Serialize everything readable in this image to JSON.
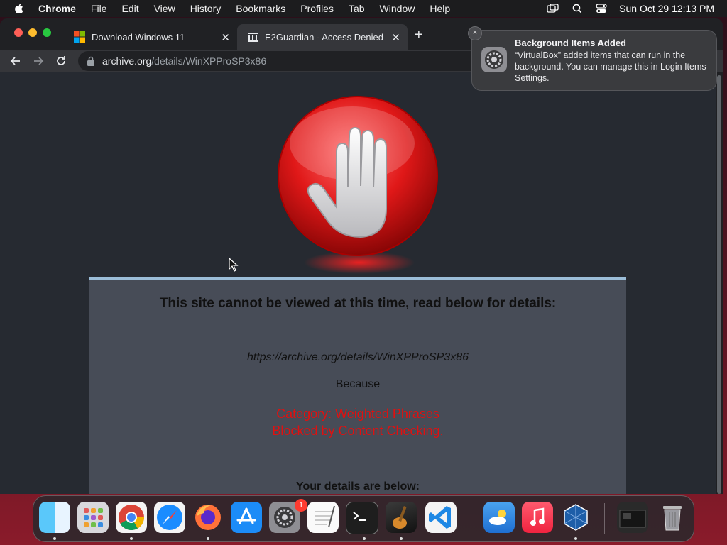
{
  "menubar": {
    "app": "Chrome",
    "items": [
      "File",
      "Edit",
      "View",
      "History",
      "Bookmarks",
      "Profiles",
      "Tab",
      "Window",
      "Help"
    ],
    "clock": "Sun Oct 29  12:13 PM"
  },
  "browser": {
    "tabs": [
      {
        "title": "Download Windows 11",
        "active": false
      },
      {
        "title": "E2Guardian - Access Denied",
        "active": true
      }
    ],
    "new_tab": "+",
    "address": {
      "host": "archive.org",
      "path": "/details/WinXPProSP3x86"
    }
  },
  "page": {
    "heading": "This site cannot be viewed at this time, read below for details:",
    "url": "https://archive.org/details/WinXPProSP3x86",
    "because": "Because",
    "reason_1": "Category: Weighted Phrases",
    "reason_2": "Blocked by Content Checking.",
    "details_heading": "Your details are below:"
  },
  "notification": {
    "title": "Background Items Added",
    "body": "“VirtualBox” added items that can run in the background. You can manage this in Login Items Settings.",
    "close": "×"
  },
  "dock": {
    "apps": [
      "finder",
      "launchpad",
      "chrome",
      "safari",
      "firefox",
      "app-store",
      "system-settings",
      "textedit",
      "terminal",
      "garageband",
      "vscode",
      "weather",
      "music",
      "virtualbox",
      "screenshot",
      "trash"
    ],
    "system_settings_badge": "1"
  },
  "colors": {
    "reason": "#e01010",
    "panel_bg": "#474c57",
    "panel_border": "#9bbdd8",
    "page_bg": "#262a31"
  }
}
